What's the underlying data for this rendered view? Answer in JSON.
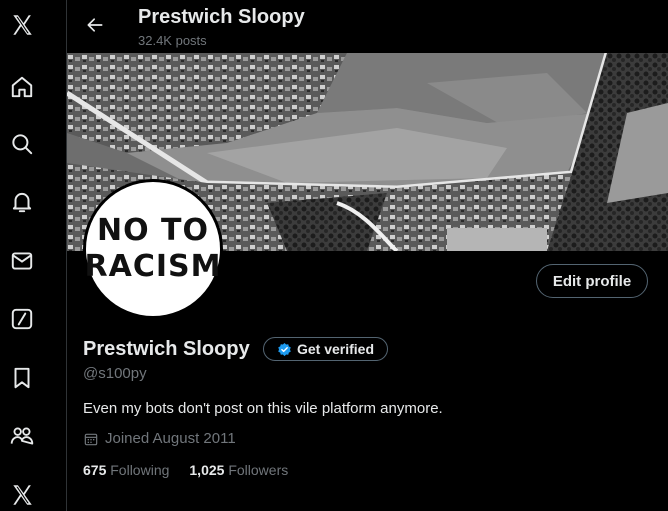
{
  "header": {
    "title": "Prestwich Sloopy",
    "posts_count": "32.4K posts"
  },
  "nav": {
    "items": [
      {
        "icon": "x-logo-icon"
      },
      {
        "icon": "home-icon"
      },
      {
        "icon": "search-icon"
      },
      {
        "icon": "notifications-icon"
      },
      {
        "icon": "messages-icon"
      },
      {
        "icon": "grok-icon"
      },
      {
        "icon": "bookmarks-icon"
      },
      {
        "icon": "communities-icon"
      },
      {
        "icon": "premium-x-icon"
      }
    ]
  },
  "avatar": {
    "line1": "NO TO",
    "line2": "RACISM"
  },
  "profile": {
    "display_name": "Prestwich Sloopy",
    "verify_label": "Get verified",
    "handle": "@s100py",
    "bio": "Even my bots don't post on this vile platform anymore.",
    "joined": "Joined August 2011",
    "edit_label": "Edit profile",
    "following_count": "675",
    "following_label": "Following",
    "followers_count": "1,025",
    "followers_label": "Followers"
  },
  "colors": {
    "background": "#000000",
    "text_primary": "#e7e9ea",
    "text_secondary": "#71767b",
    "border": "#2f3336",
    "verified_blue": "#1d9bf0"
  }
}
